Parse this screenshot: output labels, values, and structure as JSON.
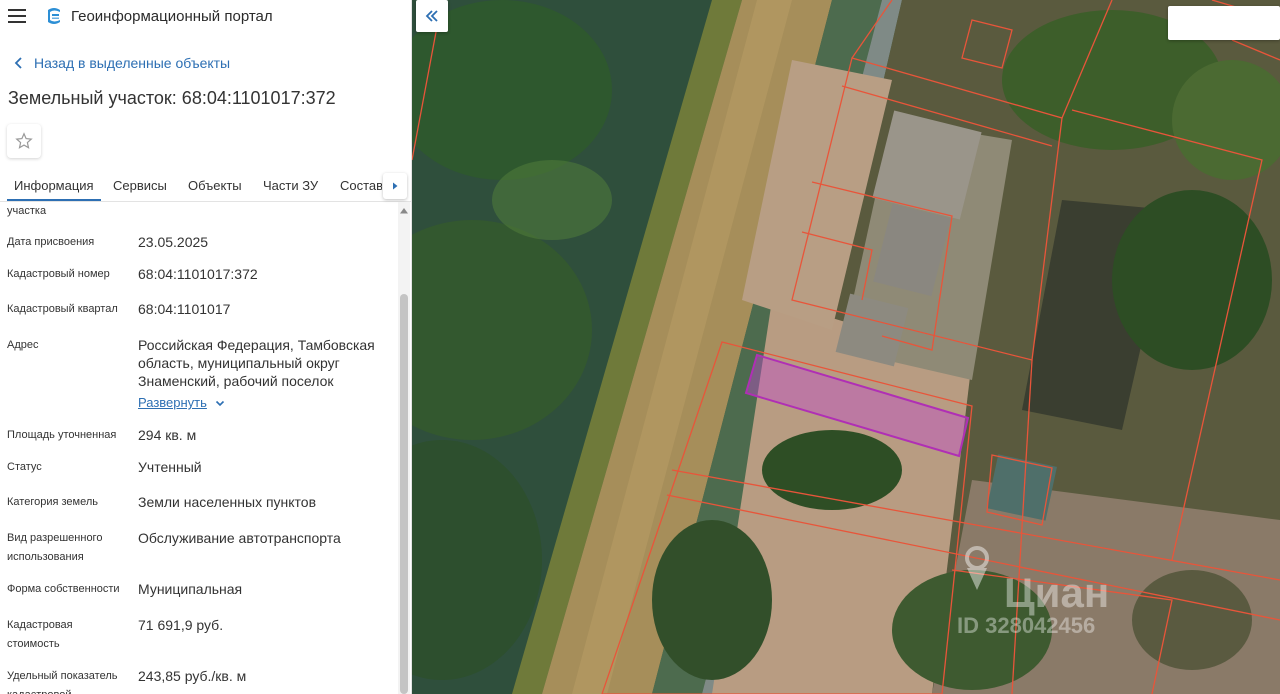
{
  "app": {
    "title": "Геоинформационный портал"
  },
  "nav": {
    "back_label": "Назад в выделенные объекты"
  },
  "object": {
    "title": "Земельный участок: 68:04:1101017:372"
  },
  "tabs": [
    {
      "label": "Информация",
      "active": true
    },
    {
      "label": "Сервисы",
      "active": false
    },
    {
      "label": "Объекты",
      "active": false
    },
    {
      "label": "Части ЗУ",
      "active": false
    },
    {
      "label": "Состав",
      "active": false
    }
  ],
  "props": {
    "partial_label": "участка",
    "rows": [
      {
        "label": "Дата присвоения",
        "value": "23.05.2025"
      },
      {
        "label": "Кадастровый номер",
        "value": "68:04:1101017:372"
      },
      {
        "label": "Кадастровый квартал",
        "value": "68:04:1101017"
      },
      {
        "label": "Адрес",
        "value": "Российская Федерация, Тамбовская область, муниципальный округ Знаменский, рабочий поселок"
      },
      {
        "label": "Площадь уточненная",
        "value": "294 кв. м"
      },
      {
        "label": "Статус",
        "value": "Учтенный"
      },
      {
        "label": "Категория земель",
        "value": "Земли населенных пунктов"
      },
      {
        "label": "Вид разрешенного использования",
        "value": "Обслуживание автотранспорта"
      },
      {
        "label": "Форма собственности",
        "value": "Муниципальная"
      },
      {
        "label": "Кадастровая стоимость",
        "value": "71 691,9 руб."
      },
      {
        "label": "Удельный показатель кадастровой",
        "value": "243,85 руб./кв. м"
      }
    ],
    "expand_label": "Развернуть"
  },
  "map": {
    "watermark_brand": "Циан",
    "watermark_id": "ID 328042456",
    "selected_color": "#b02fb5",
    "parcel_color": "#e8553a"
  }
}
